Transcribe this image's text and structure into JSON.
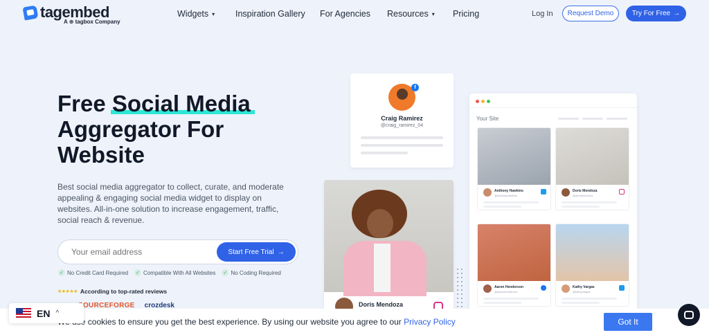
{
  "header": {
    "logo_text": "tagembed",
    "logo_sub": "A ⊕ tagbox Company",
    "nav": [
      {
        "label": "Widgets",
        "caret": "▾"
      },
      {
        "label": "Inspiration Gallery"
      },
      {
        "label": "For Agencies"
      },
      {
        "label": "Resources",
        "caret": "▾"
      },
      {
        "label": "Pricing"
      }
    ],
    "login": "Log In",
    "request_demo": "Request Demo",
    "try_free": "Try For Free",
    "arrow": "→"
  },
  "hero": {
    "title_lead": "Free ",
    "title_highlight": "Social Media",
    "title_rest": "Aggregator For Website",
    "description": "Best social media aggregator to collect, curate, and moderate appealing & engaging social media widget to display on websites. All-in-one solution to increase engagement, traffic, social reach & revenue.",
    "email_placeholder": "Your email address",
    "cta": "Start Free Trial",
    "cta_arrow": "→",
    "checks": [
      "No Credit Card Required",
      "Compatible With All Websites",
      "No Coding Required"
    ],
    "check_mark": "✓",
    "stars": "★★★★★",
    "reviews": "According to top-rated reviews",
    "brands": [
      "SOURCEFORGE",
      "crozdesk"
    ]
  },
  "profile_card": {
    "name": "Craig Ramirez",
    "handle": "@craig_ramirez_04",
    "network_glyph": "f"
  },
  "photo_card": {
    "name": "Doris Mendoza"
  },
  "site_window": {
    "label": "Your Site",
    "tiles": [
      {
        "name": "Anthony Hawkins",
        "handle": "@anthonyhawkins",
        "network": "twitter"
      },
      {
        "name": "Doris Mendoza",
        "handle": "@dorismendoza",
        "network": "instagram"
      },
      {
        "name": "Aaron Henderson",
        "handle": "@aaronhenderson",
        "network": "facebook"
      },
      {
        "name": "Kathy Vargas",
        "handle": "@kathyvargas",
        "network": "twitter"
      }
    ]
  },
  "cookie": {
    "text": "We use cookies to ensure you get the best experience. By using our website you agree to our ",
    "link": "Privacy Policy",
    "button": "Got It"
  },
  "language": {
    "code": "EN",
    "caret": "^"
  },
  "colors": {
    "primary": "#2f62e6",
    "highlight": "#2ee6d6",
    "background": "#eef3fb"
  }
}
